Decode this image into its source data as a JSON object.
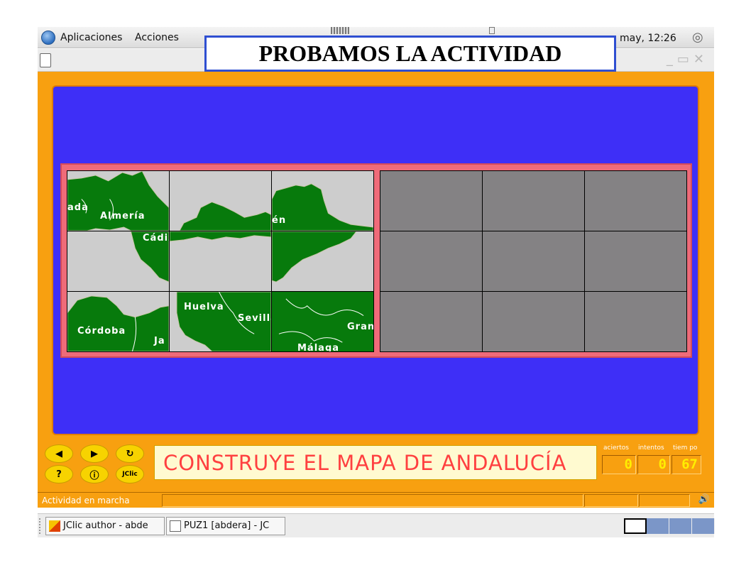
{
  "caption": "PROBAMOS LA ACTIVIDAD",
  "top_panel": {
    "menu_apps": "Aplicaciones",
    "menu_actions": "Acciones",
    "clock": "may, 12:26"
  },
  "puzzle": {
    "pieces": [
      {
        "labels": [
          "ada",
          "Almería"
        ]
      },
      {
        "labels": []
      },
      {
        "labels": [
          "én"
        ]
      },
      {
        "labels": [
          "Cádiz"
        ]
      },
      {
        "labels": []
      },
      {
        "labels": []
      },
      {
        "labels": [
          "Córdoba",
          "Ja"
        ]
      },
      {
        "labels": [
          "Huelva",
          "Sevilla"
        ]
      },
      {
        "labels": [
          "Gran",
          "Málaga"
        ]
      }
    ]
  },
  "controls": {
    "prev_icon": "left-arrow-icon",
    "next_icon": "right-arrow-icon",
    "reset_icon": "restart-icon",
    "help_label": "?",
    "info_label": "ⓘ",
    "jclic_label": "JClic",
    "message": "CONSTRUYE EL MAPA DE ANDALUCÍA",
    "counters": {
      "aciertos_label": "aciertos",
      "intentos_label": "intentos",
      "tiempo_label": "tiem po",
      "aciertos": "0",
      "intentos": "0",
      "tiempo": "67"
    }
  },
  "status": {
    "text": "Actividad en marcha"
  },
  "taskbar": {
    "tasks": [
      {
        "label": "JClic author - abde",
        "icon": "jclic-author-icon"
      },
      {
        "label": "PUZ1 [abdera] - JC",
        "icon": "window-icon"
      }
    ]
  },
  "colors": {
    "frame_orange": "#f8a010",
    "board_blue": "#3e2ff7",
    "board_border": "#ef6b79",
    "map_green": "#077a0c",
    "message_red": "#ff4040"
  }
}
